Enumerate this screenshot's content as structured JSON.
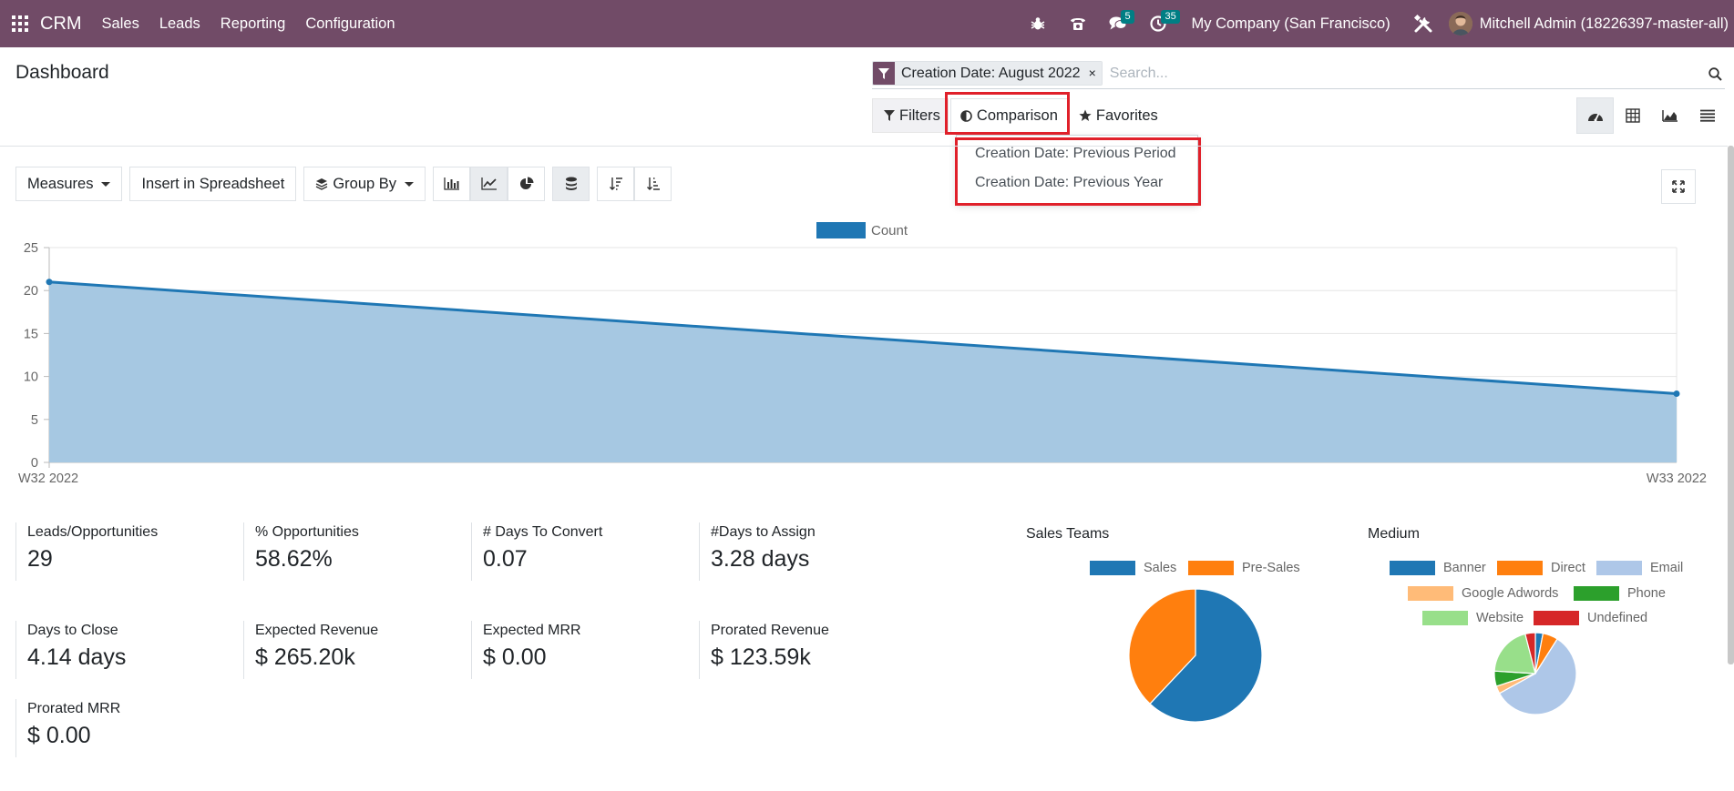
{
  "navbar": {
    "brand": "CRM",
    "menus": [
      "Sales",
      "Leads",
      "Reporting",
      "Configuration"
    ],
    "messages_badge": "5",
    "activities_badge": "35",
    "company": "My Company (San Francisco)",
    "user": "Mitchell Admin (18226397-master-all)",
    "icons": [
      "apps-grid-icon",
      "bug-icon",
      "phone-icon",
      "chat-icon",
      "clock-icon",
      "tools-icon"
    ]
  },
  "control_panel": {
    "title": "Dashboard",
    "facet": "Creation Date: August 2022",
    "search_placeholder": "Search...",
    "filters_label": "Filters",
    "comparison_label": "Comparison",
    "favorites_label": "Favorites",
    "comparison_options": [
      "Creation Date: Previous Period",
      "Creation Date: Previous Year"
    ],
    "views": [
      "dashboard-view",
      "pivot-view",
      "graph-view",
      "list-view"
    ]
  },
  "toolbar": {
    "measures": "Measures",
    "insert_spreadsheet": "Insert in Spreadsheet",
    "group_by": "Group By"
  },
  "chart_data": [
    {
      "type": "area",
      "x": [
        "W32 2022",
        "W33 2022"
      ],
      "series": [
        {
          "name": "Count",
          "values": [
            21,
            8
          ],
          "color": "#1f77b4"
        }
      ],
      "ylim": [
        0,
        25
      ],
      "yticks": [
        0,
        5,
        10,
        15,
        20,
        25
      ],
      "legend": "top-center",
      "grid": true
    },
    {
      "type": "pie",
      "title": "Sales Teams",
      "categories": [
        "Sales",
        "Pre-Sales"
      ],
      "values": [
        62,
        38
      ],
      "colors": [
        "#1f77b4",
        "#ff7f0e"
      ],
      "legend": "top"
    },
    {
      "type": "pie",
      "title": "Medium",
      "categories": [
        "Banner",
        "Direct",
        "Email",
        "Google Adwords",
        "Phone",
        "Website",
        "Undefined"
      ],
      "values": [
        3,
        6,
        58,
        3,
        6,
        20,
        4
      ],
      "colors": [
        "#1f77b4",
        "#ff7f0e",
        "#aec7e8",
        "#ffbb78",
        "#2ca02c",
        "#98df8a",
        "#d62728"
      ],
      "legend": "top"
    }
  ],
  "kpis": [
    {
      "label": "Leads/Opportunities",
      "value": "29"
    },
    {
      "label": "% Opportunities",
      "value": "58.62%"
    },
    {
      "label": "# Days To Convert",
      "value": "0.07"
    },
    {
      "label": "#Days to Assign",
      "value": "3.28 days"
    },
    {
      "label": "Days to Close",
      "value": "4.14 days"
    },
    {
      "label": "Expected Revenue",
      "value": "$ 265.20k"
    },
    {
      "label": "Expected MRR",
      "value": "$ 0.00"
    },
    {
      "label": "Prorated Revenue",
      "value": "$ 123.59k"
    },
    {
      "label": "Prorated MRR",
      "value": "$ 0.00"
    }
  ]
}
